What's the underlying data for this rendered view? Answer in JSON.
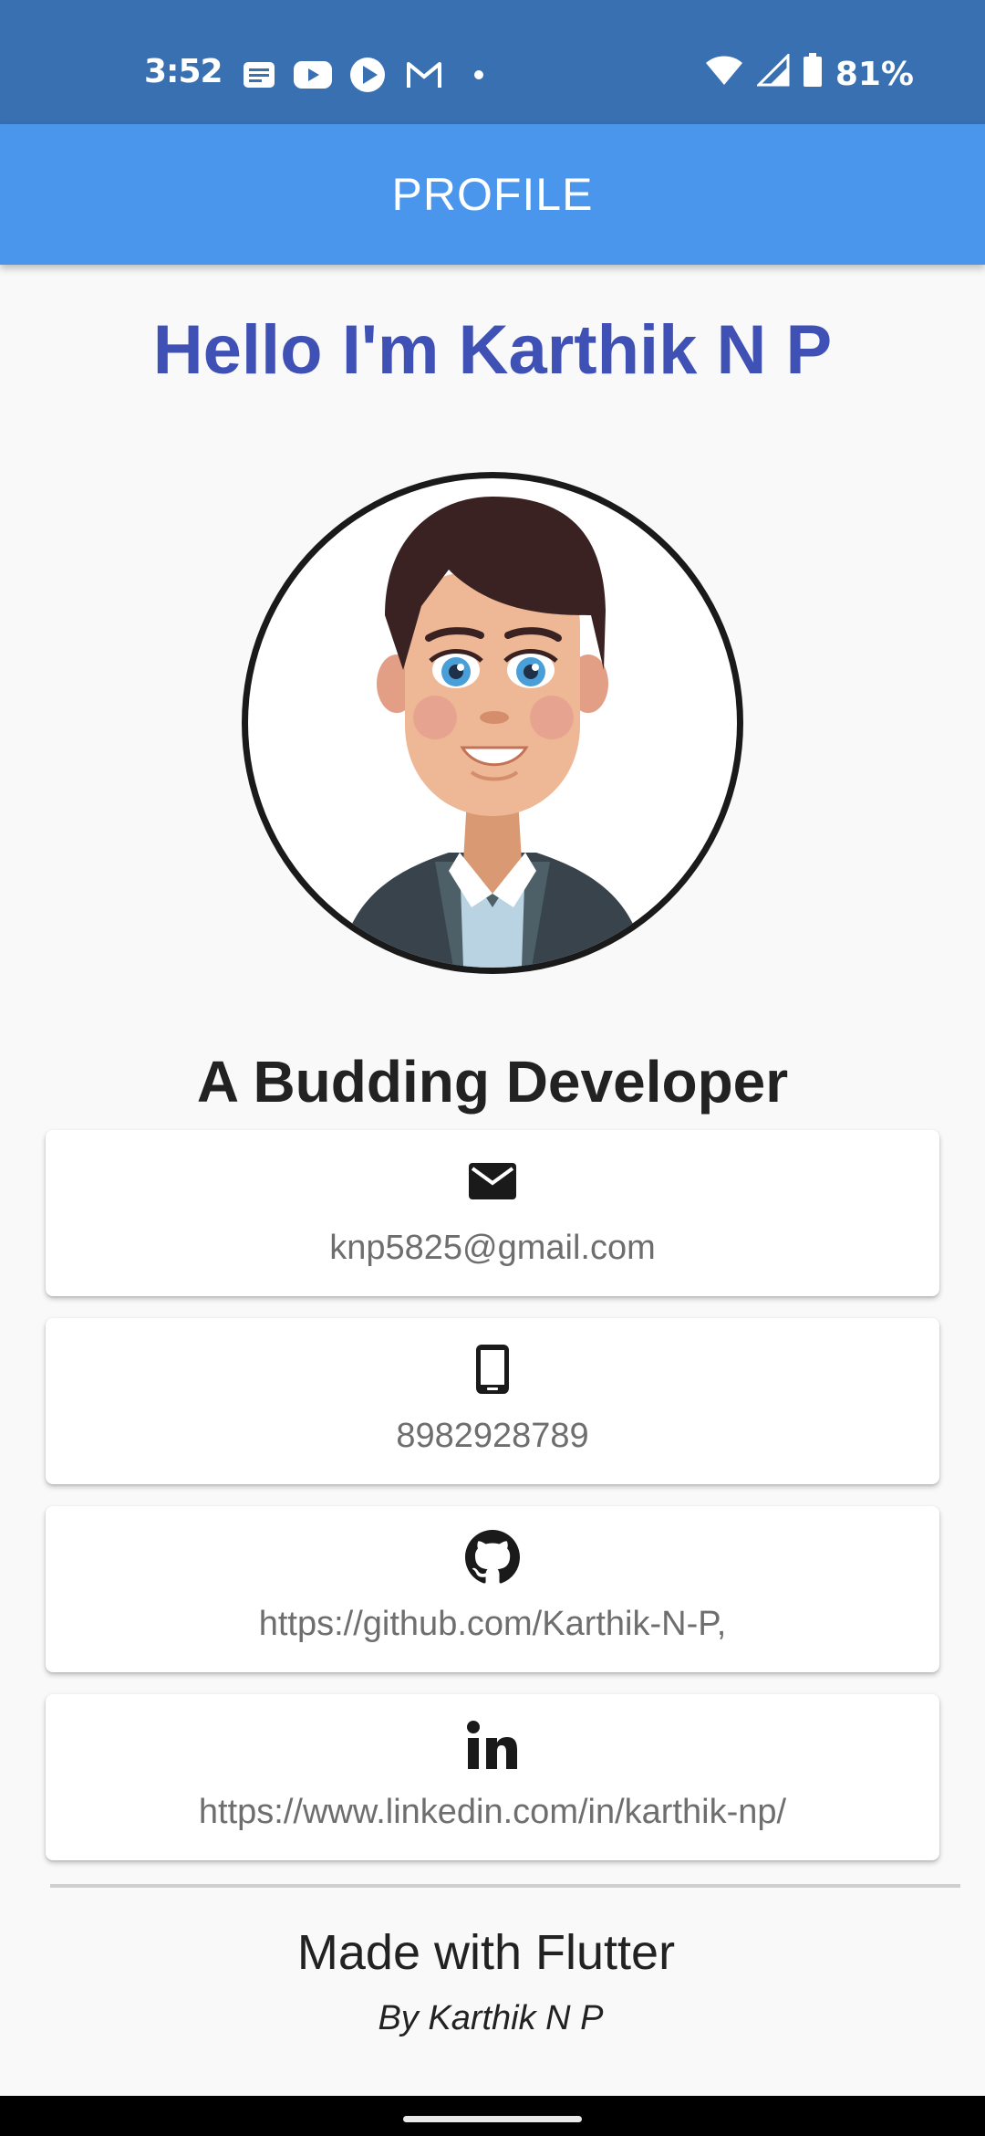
{
  "status_bar": {
    "time": "3:52",
    "battery": "81%",
    "notification_icons": [
      "news-icon",
      "youtube-icon",
      "play-icon",
      "gmail-icon",
      "dot-icon"
    ],
    "system_icons": [
      "wifi-icon",
      "signal-icon",
      "battery-icon"
    ],
    "background_color": "#3870b2"
  },
  "app_bar": {
    "title": "PROFILE",
    "background_color": "#4a96ec"
  },
  "profile": {
    "greeting": "Hello I'm Karthik N P",
    "greeting_color": "#3f51b5",
    "avatar_icon": "cartoon-avatar",
    "tagline": "A Budding Developer"
  },
  "contacts": [
    {
      "icon": "mail-icon",
      "text": "knp5825@gmail.com"
    },
    {
      "icon": "phone-icon",
      "text": "8982928789"
    },
    {
      "icon": "github-icon",
      "text": "https://github.com/Karthik-N-P,"
    },
    {
      "icon": "linkedin-icon",
      "text": "https://www.linkedin.com/in/karthik-np/"
    }
  ],
  "footer": {
    "title": "Made with Flutter",
    "subtitle": "By Karthik N P"
  }
}
